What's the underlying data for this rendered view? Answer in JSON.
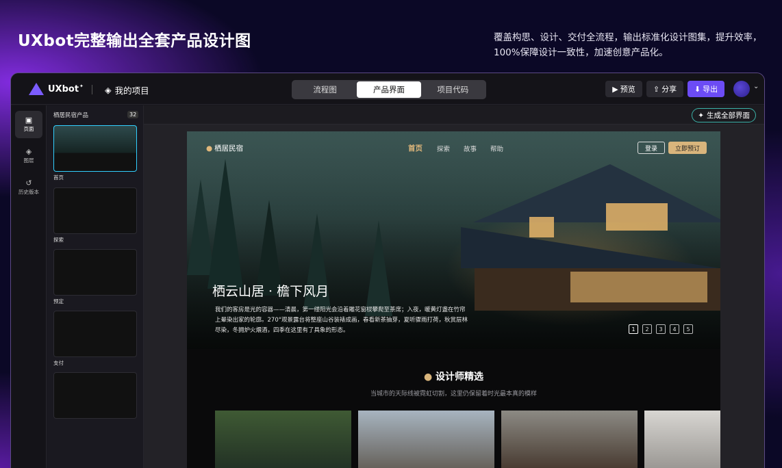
{
  "hero": {
    "title": "UXbot完整输出全套产品设计图",
    "description": "覆盖构思、设计、交付全流程，输出标准化设计图集，提升效率，100%保障设计一致性，加速创意产品化。"
  },
  "topbar": {
    "logo": "UXbot",
    "project": "我的项目",
    "tabs": [
      {
        "label": "流程图",
        "active": false
      },
      {
        "label": "产品界面",
        "active": true
      },
      {
        "label": "项目代码",
        "active": false
      }
    ],
    "preview": "预览",
    "share": "分享",
    "export": "导出"
  },
  "rail": {
    "items": [
      {
        "label": "页面",
        "icon": "page-icon"
      },
      {
        "label": "图层",
        "icon": "layers-icon"
      },
      {
        "label": "历史版本",
        "icon": "history-icon"
      }
    ]
  },
  "pages_panel": {
    "title": "栖居民宿产品",
    "count": "32",
    "pages": [
      {
        "label": "首页"
      },
      {
        "label": "探索"
      },
      {
        "label": "预定"
      },
      {
        "label": "支付"
      },
      {
        "label": ""
      }
    ]
  },
  "canvas": {
    "generate_all": "生成全部界面"
  },
  "site": {
    "logo": "栖居民宿",
    "nav": [
      "首页",
      "探索",
      "故事",
      "帮助"
    ],
    "login": "登录",
    "book": "立即预订",
    "hero_title": "栖云山居 · 檐下风月",
    "hero_text": "我们的客房是光的容器——清晨，第一缕阳光会沿着雕花窗棂攀爬至茶席；入夜，暖黄灯盏在竹帘上晕染出家的轮廓。270°观景露台将整座山谷装裱成画，春看新茶抽芽，夏听骤雨打荷，秋赏层林尽染，冬拥炉火煨酒，四季在这里有了具象的形态。",
    "pager": [
      "1",
      "2",
      "3",
      "4",
      "5"
    ],
    "section_title": "设计师精选",
    "section_sub": "当城市的天际线被霓虹切割，这里仍保留着时光最本真的模样"
  },
  "colors": {
    "accent": "#6c4cf5",
    "gold": "#d9b57c",
    "selection": "#31d0ff"
  }
}
